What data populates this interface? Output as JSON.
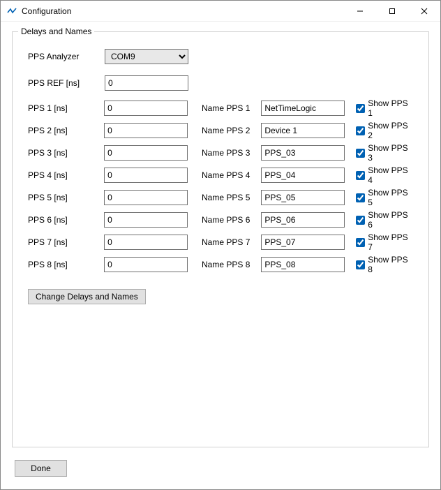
{
  "window": {
    "title": "Configuration",
    "minimize_tooltip": "Minimize",
    "maximize_tooltip": "Maximize",
    "close_tooltip": "Close"
  },
  "group": {
    "legend": "Delays and Names"
  },
  "analyzer": {
    "label": "PPS Analyzer",
    "value": "COM9",
    "options": [
      "COM9"
    ]
  },
  "ref": {
    "label": "PPS REF [ns]",
    "value": "0"
  },
  "pps": [
    {
      "delay_label": "PPS 1 [ns]",
      "delay_value": "0",
      "name_label": "Name PPS 1",
      "name_value": "NetTimeLogic",
      "show_label": "Show PPS 1",
      "show_checked": true
    },
    {
      "delay_label": "PPS 2 [ns]",
      "delay_value": "0",
      "name_label": "Name PPS 2",
      "name_value": "Device 1",
      "show_label": "Show PPS 2",
      "show_checked": true
    },
    {
      "delay_label": "PPS 3 [ns]",
      "delay_value": "0",
      "name_label": "Name PPS 3",
      "name_value": "PPS_03",
      "show_label": "Show PPS 3",
      "show_checked": true
    },
    {
      "delay_label": "PPS 4 [ns]",
      "delay_value": "0",
      "name_label": "Name PPS 4",
      "name_value": "PPS_04",
      "show_label": "Show PPS 4",
      "show_checked": true
    },
    {
      "delay_label": "PPS 5 [ns]",
      "delay_value": "0",
      "name_label": "Name PPS 5",
      "name_value": "PPS_05",
      "show_label": "Show PPS 5",
      "show_checked": true
    },
    {
      "delay_label": "PPS 6 [ns]",
      "delay_value": "0",
      "name_label": "Name PPS 6",
      "name_value": "PPS_06",
      "show_label": "Show PPS 6",
      "show_checked": true
    },
    {
      "delay_label": "PPS 7 [ns]",
      "delay_value": "0",
      "name_label": "Name PPS 7",
      "name_value": "PPS_07",
      "show_label": "Show PPS 7",
      "show_checked": true
    },
    {
      "delay_label": "PPS 8 [ns]",
      "delay_value": "0",
      "name_label": "Name PPS 8",
      "name_value": "PPS_08",
      "show_label": "Show PPS 8",
      "show_checked": true
    }
  ],
  "buttons": {
    "change": "Change Delays and Names",
    "done": "Done"
  }
}
